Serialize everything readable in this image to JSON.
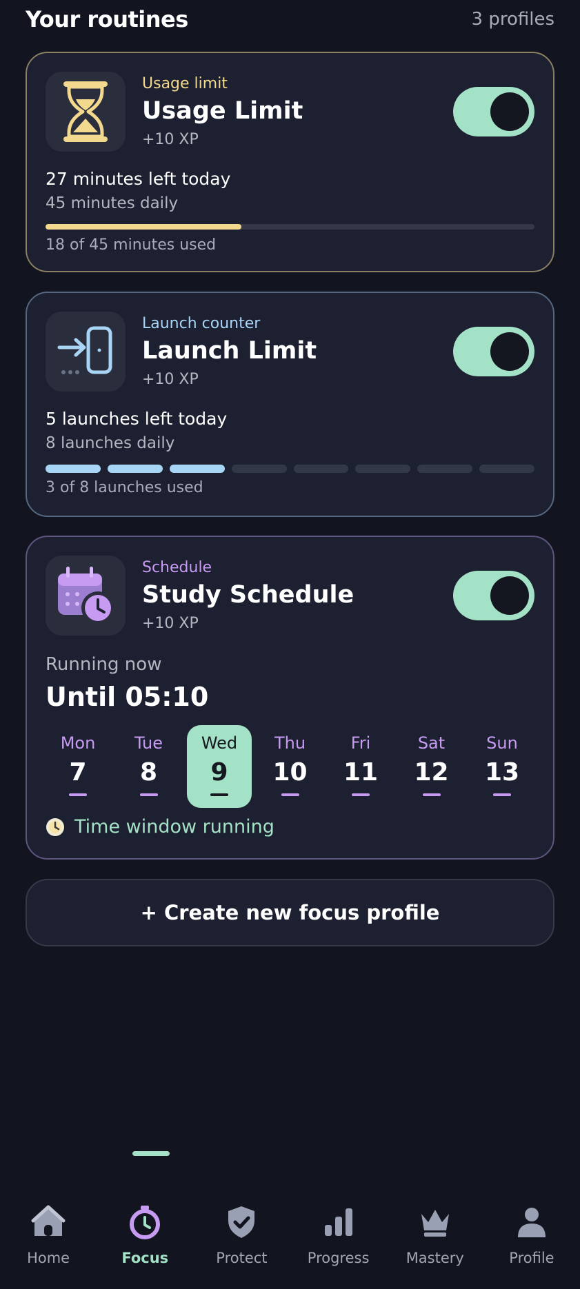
{
  "header": {
    "title": "Your routines",
    "count": "3 profiles"
  },
  "colors": {
    "background": "#12141f",
    "card": "#1d2030",
    "accent_mint": "#a4e2c7",
    "usage_yellow": "#f3d98d",
    "launch_blue": "#a8d4f6",
    "schedule_purple": "#c69bf1"
  },
  "cards": {
    "usage": {
      "icon": "hourglass-icon",
      "kicker": "Usage limit",
      "name": "Usage Limit",
      "xp": "+10 XP",
      "enabled": true,
      "remaining": "27 minutes left today",
      "daily": "45 minutes daily",
      "used_minutes": 18,
      "total_minutes": 45,
      "progress_fraction": 0.4,
      "footer": "18 of 45 minutes used"
    },
    "launch": {
      "icon": "door-enter-icon",
      "kicker": "Launch counter",
      "name": "Launch Limit",
      "xp": "+10 XP",
      "enabled": true,
      "remaining": "5 launches left today",
      "daily": "8 launches daily",
      "used": 3,
      "total": 8,
      "footer": "3 of 8 launches used"
    },
    "schedule": {
      "icon": "calendar-clock-icon",
      "kicker": "Schedule",
      "name": "Study Schedule",
      "xp": "+10 XP",
      "enabled": true,
      "state": "Running now",
      "until": "Until 05:10",
      "days": [
        {
          "name": "Mon",
          "date": "7",
          "today": false
        },
        {
          "name": "Tue",
          "date": "8",
          "today": false
        },
        {
          "name": "Wed",
          "date": "9",
          "today": true
        },
        {
          "name": "Thu",
          "date": "10",
          "today": false
        },
        {
          "name": "Fri",
          "date": "11",
          "today": false
        },
        {
          "name": "Sat",
          "date": "12",
          "today": false
        },
        {
          "name": "Sun",
          "date": "13",
          "today": false
        }
      ],
      "status": "Time window running",
      "status_icon": "clock-icon"
    }
  },
  "create_button": "+ Create new focus profile",
  "nav": [
    {
      "label": "Home",
      "icon": "home-icon",
      "active": false
    },
    {
      "label": "Focus",
      "icon": "stopwatch-icon",
      "active": true
    },
    {
      "label": "Protect",
      "icon": "shield-check-icon",
      "active": false
    },
    {
      "label": "Progress",
      "icon": "bar-chart-icon",
      "active": false
    },
    {
      "label": "Mastery",
      "icon": "crown-icon",
      "active": false
    },
    {
      "label": "Profile",
      "icon": "person-icon",
      "active": false
    }
  ]
}
